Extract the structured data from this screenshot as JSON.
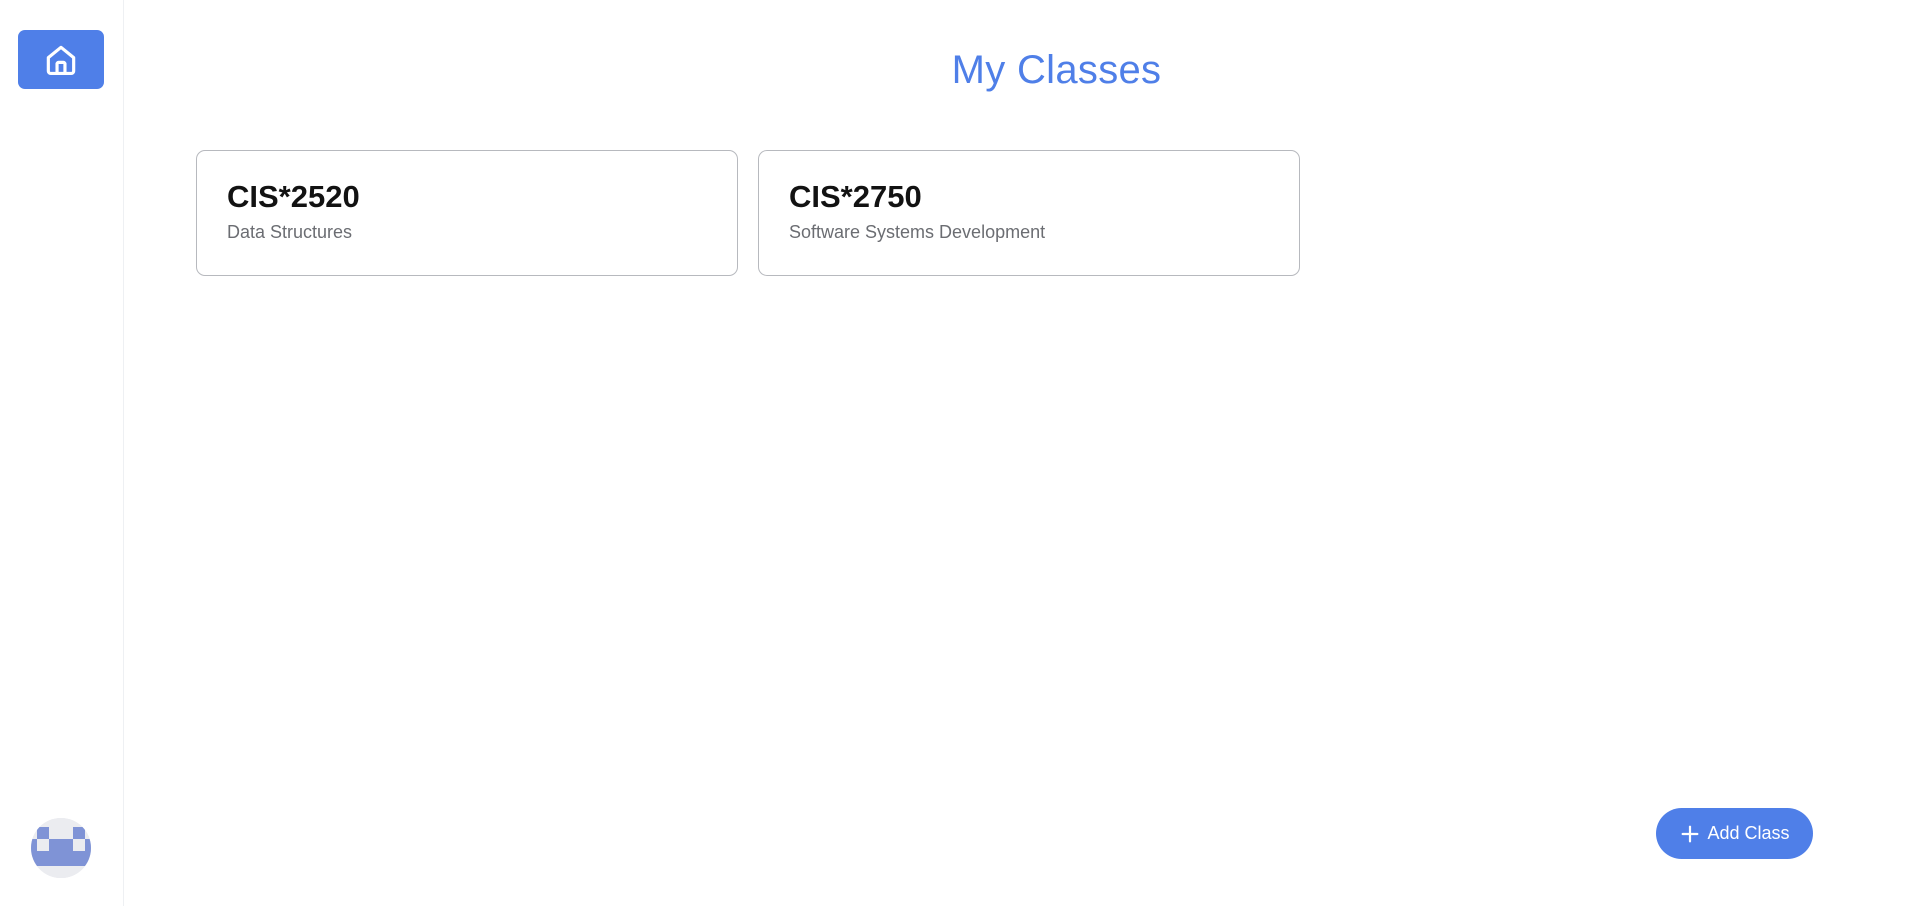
{
  "colors": {
    "accent": "#4f7fe8",
    "card_border": "#b7b9be",
    "card_title": "#121212",
    "card_subtitle": "#6b6d72"
  },
  "sidebar": {
    "home_icon": "home-icon",
    "avatar_icon": "user-avatar"
  },
  "main": {
    "title": "My Classes",
    "classes": [
      {
        "code": "CIS*2520",
        "name": "Data Structures"
      },
      {
        "code": "CIS*2750",
        "name": "Software Systems Development"
      }
    ],
    "add_button": {
      "icon": "plus-icon",
      "label": "Add Class"
    }
  }
}
